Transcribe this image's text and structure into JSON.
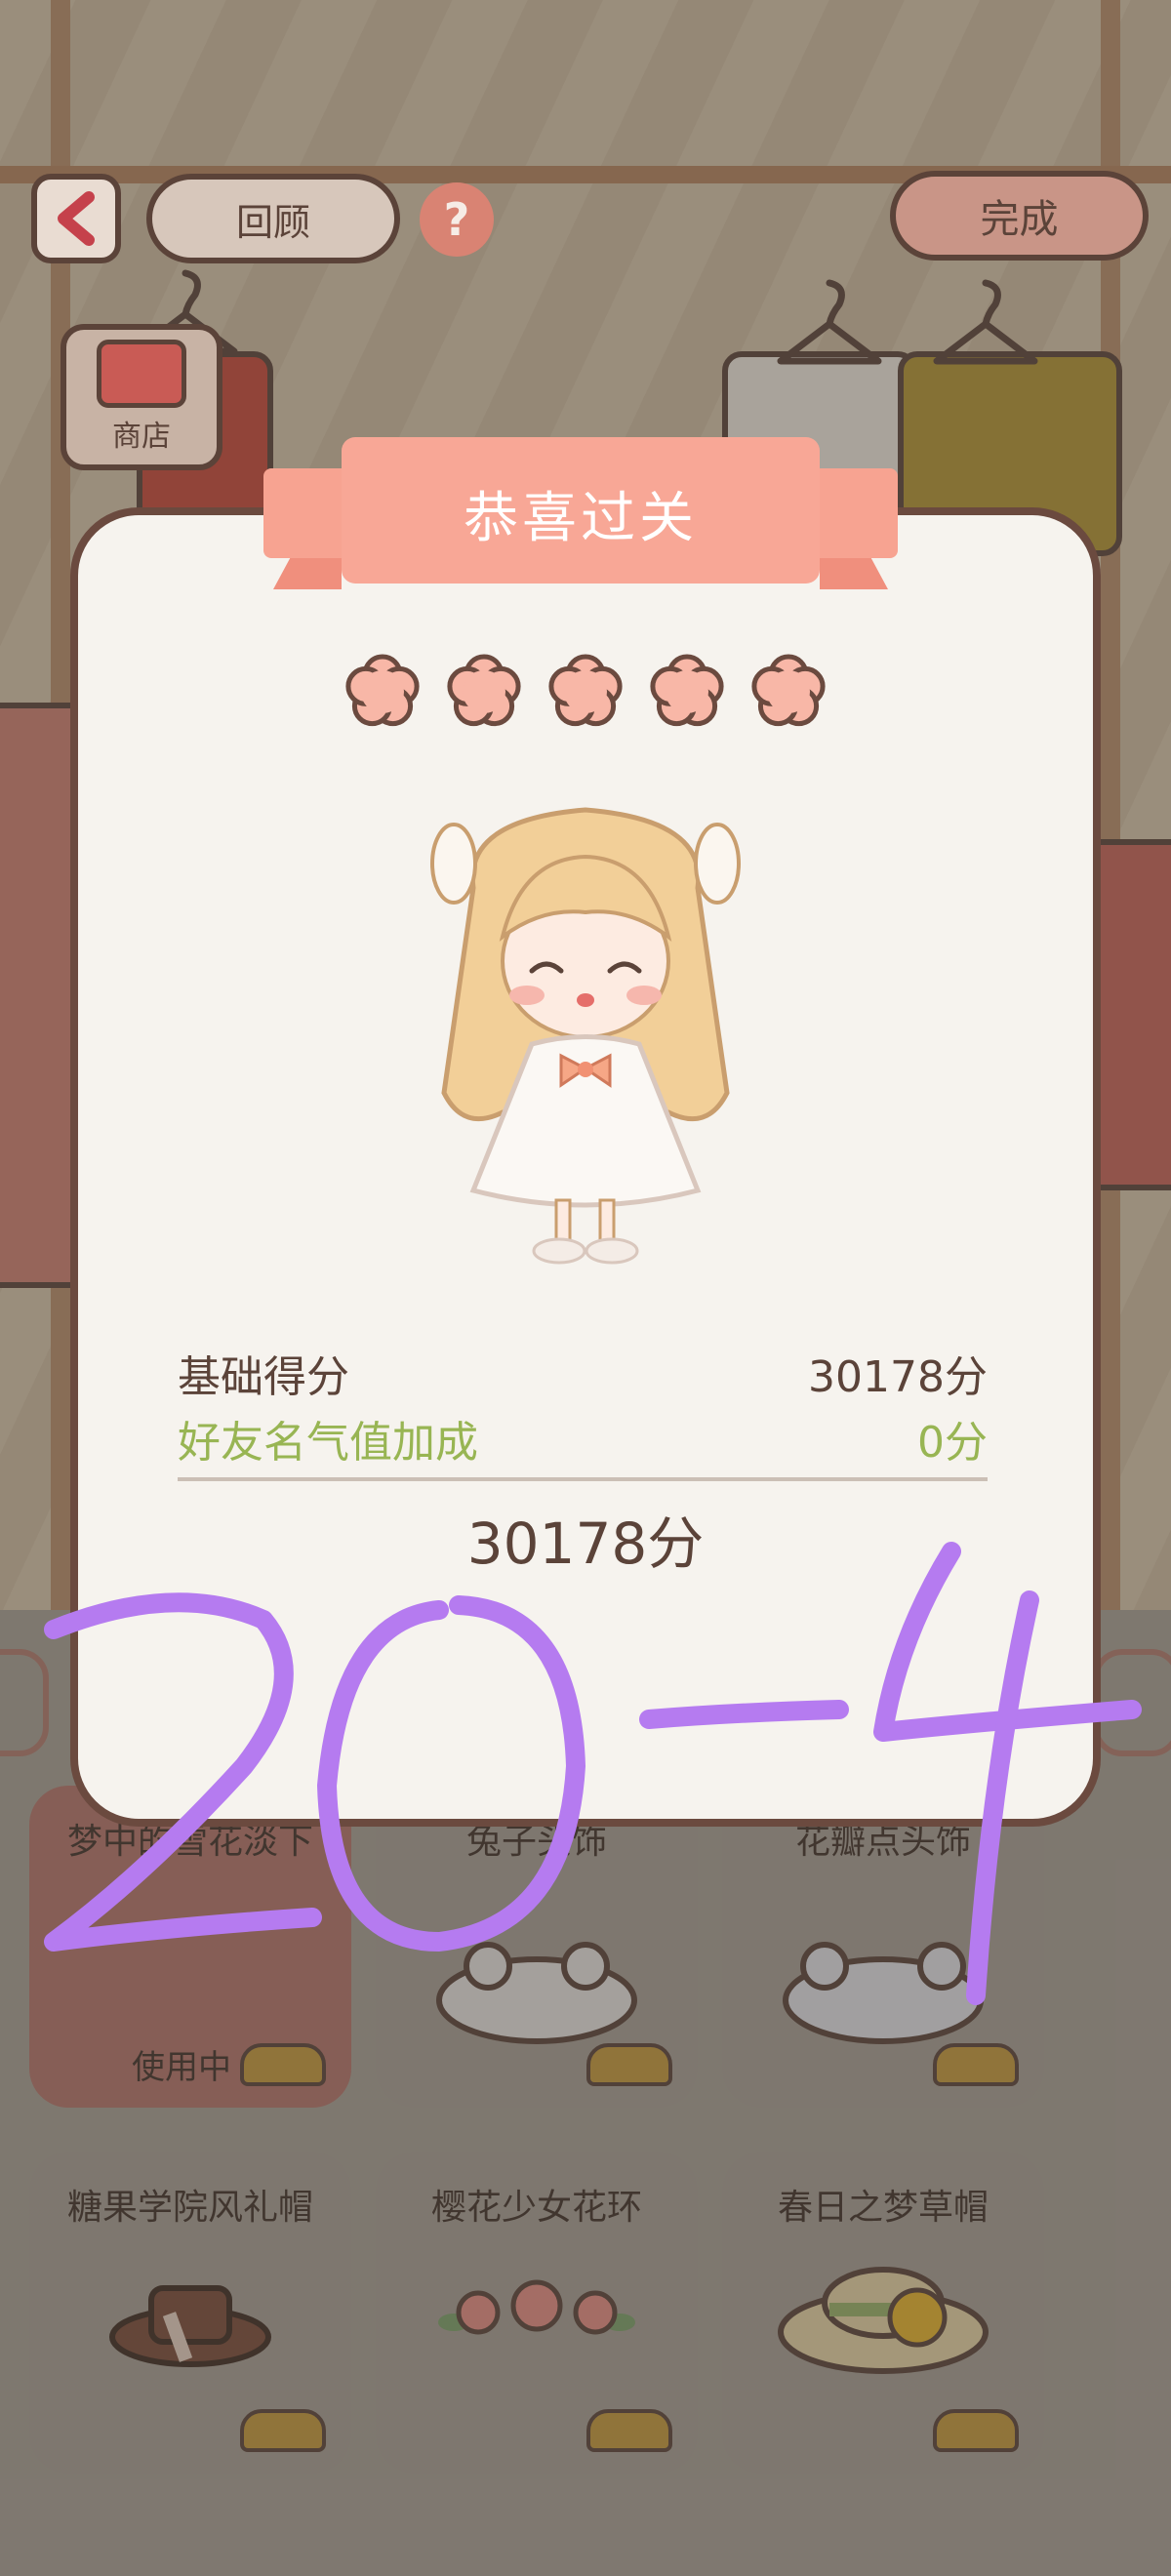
{
  "top_bar": {
    "review_label": "回顾",
    "help_label": "?",
    "done_label": "完成",
    "shop_label": "商店"
  },
  "modal": {
    "title": "恭喜过关",
    "stars": 5,
    "base_score_label": "基础得分",
    "base_score_value": "30178分",
    "bonus_label": "好友名气值加成",
    "bonus_value": "0分",
    "total_score": "30178分"
  },
  "items_row1": [
    {
      "name": "梦中的雪花淡下",
      "status": "使用中"
    },
    {
      "name": "兔子头饰",
      "status": ""
    },
    {
      "name": "花瓣点头饰",
      "status": ""
    }
  ],
  "items_row2": [
    {
      "name": "糖果学院风礼帽",
      "status": ""
    },
    {
      "name": "樱花少女花环",
      "status": ""
    },
    {
      "name": "春日之梦草帽",
      "status": ""
    }
  ],
  "handwriting_text": "20-4",
  "colors": {
    "modal_bg": "#f6f3ee",
    "ribbon": "#f7a391",
    "bonus_green": "#98b553",
    "handwriting_purple": "#b57bf0",
    "outline_brown": "#5b4339"
  }
}
